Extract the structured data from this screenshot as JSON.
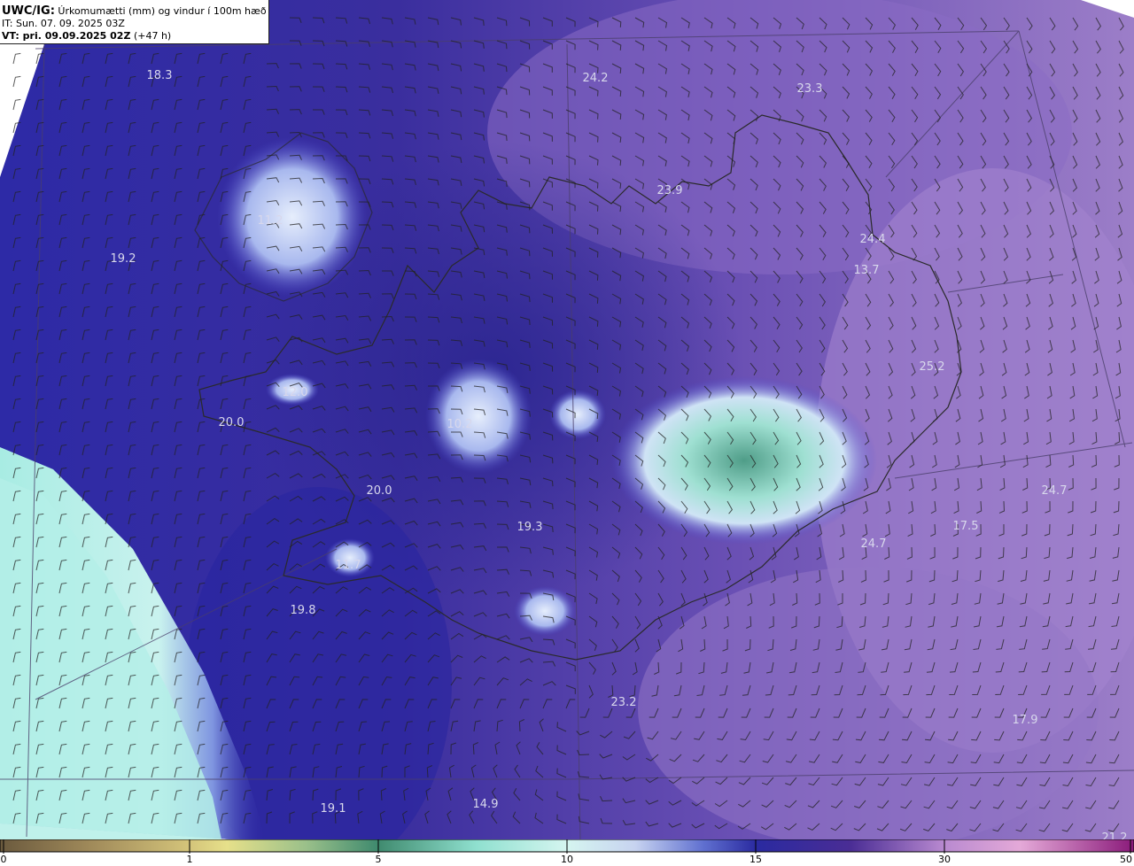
{
  "header": {
    "source": "UWC/IG:",
    "title": "Úrkomumætti (mm) og vindur í 100m hæð",
    "it": "IT: Sun. 07. 09. 2025 03Z",
    "vt_label": "VT: pri. 09.09.2025 02Z",
    "vt_lead": "(+47 h)"
  },
  "value_labels": [
    {
      "text": "18.3"
    },
    {
      "text": "24.2"
    },
    {
      "text": "23.3"
    },
    {
      "text": "23.9"
    },
    {
      "text": "11.2"
    },
    {
      "text": "19.2"
    },
    {
      "text": "24.4"
    },
    {
      "text": "13.7"
    },
    {
      "text": "25.2"
    },
    {
      "text": "12.0"
    },
    {
      "text": "20.0"
    },
    {
      "text": "10.2"
    },
    {
      "text": "20.0"
    },
    {
      "text": "24.7"
    },
    {
      "text": "17.5"
    },
    {
      "text": "19.3"
    },
    {
      "text": "24.7"
    },
    {
      "text": "11.7"
    },
    {
      "text": "19.8"
    },
    {
      "text": "23.2"
    },
    {
      "text": "17.9"
    },
    {
      "text": "19.1"
    },
    {
      "text": "14.9"
    },
    {
      "text": "21.2"
    }
  ],
  "colorbar": {
    "ticks": [
      "0",
      "1",
      "5",
      "10",
      "15",
      "30",
      "50"
    ],
    "colors": [
      "#6b5a3e",
      "#b9a36a",
      "#e6e08a",
      "#3f8a6e",
      "#8fe0cf",
      "#d5f5f0",
      "#c7d3f0",
      "#2a2aa0",
      "#3a2288",
      "#7a55b5",
      "#b98ad0",
      "#e4a9d8",
      "#8a1a7a"
    ]
  }
}
